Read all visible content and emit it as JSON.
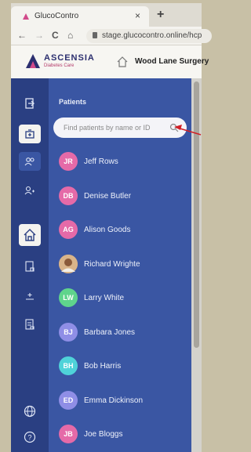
{
  "browser": {
    "tab_title": "GlucoContro",
    "tab_close": "×",
    "new_tab": "+",
    "nav_back": "←",
    "nav_forward": "→",
    "nav_reload": "C",
    "nav_home": "⌂",
    "url": "stage.glucocontro.online/hcp"
  },
  "header": {
    "brand_name": "ASCENSIA",
    "brand_sub": "Diabetes Care",
    "practice": "Wood Lane Surgery",
    "brand_color": "#2c2f6f",
    "brand_accent": "#b43a6a"
  },
  "rail": {
    "icons": [
      "exit-icon",
      "clinic-icon",
      "patients-icon",
      "add-user-icon",
      "home-icon",
      "reports-icon",
      "sugar-icon",
      "document-icon",
      "globe-icon",
      "help-icon"
    ]
  },
  "patients": {
    "title": "Patients",
    "search_placeholder": "Find patients by name or ID",
    "list": [
      {
        "initials": "JR",
        "name": "Jeff Rows",
        "color": "#e56aa8"
      },
      {
        "initials": "DB",
        "name": "Denise Butler",
        "color": "#e56aa8"
      },
      {
        "initials": "AG",
        "name": "Alison Goods",
        "color": "#e56aa8"
      },
      {
        "initials": "",
        "name": "Richard Wrighte",
        "color": "#c89a6a"
      },
      {
        "initials": "LW",
        "name": "Larry White",
        "color": "#5fd48c"
      },
      {
        "initials": "BJ",
        "name": "Barbara Jones",
        "color": "#8f8ee6"
      },
      {
        "initials": "BH",
        "name": "Bob Harris",
        "color": "#4fd3d9"
      },
      {
        "initials": "ED",
        "name": "Emma Dickinson",
        "color": "#8f8ee6"
      },
      {
        "initials": "JB",
        "name": "Joe Bloggs",
        "color": "#e56aa8"
      }
    ]
  },
  "colors": {
    "rail": "#2a3f82",
    "panel": "#3a56a3",
    "annotation_arrow": "#d11f25"
  }
}
